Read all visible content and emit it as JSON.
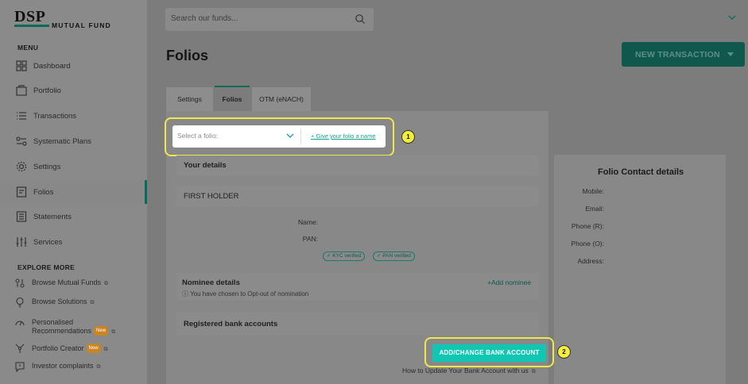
{
  "brand": {
    "name": "DSP",
    "tagline": "MUTUAL FUND",
    "color": "#0b6b5b"
  },
  "search": {
    "placeholder": "Search our funds..."
  },
  "sidebar": {
    "menu_title": "MENU",
    "items": [
      {
        "label": "Dashboard",
        "icon": "dashboard-icon"
      },
      {
        "label": "Portfolio",
        "icon": "portfolio-icon"
      },
      {
        "label": "Transactions",
        "icon": "transactions-icon"
      },
      {
        "label": "Systematic Plans",
        "icon": "systematic-plans-icon"
      },
      {
        "label": "Settings",
        "icon": "gear-icon"
      },
      {
        "label": "Folios",
        "icon": "folio-icon",
        "active": true
      },
      {
        "label": "Statements",
        "icon": "statements-icon"
      },
      {
        "label": "Services",
        "icon": "services-icon"
      }
    ],
    "explore_title": "EXPLORE MORE",
    "explore": [
      {
        "label": "Browse Mutual Funds",
        "icon": "browse-funds-icon"
      },
      {
        "label": "Browse Solutions",
        "icon": "bulb-icon"
      },
      {
        "label_line1": "Personalised",
        "label_line2": "Recommendations",
        "badge": "New",
        "icon": "gauge-icon"
      },
      {
        "label": "Portfolio Creator",
        "badge": "New",
        "icon": "portfolio-creator-icon"
      },
      {
        "label": "Investor complaints",
        "icon": "complaint-icon"
      }
    ]
  },
  "page": {
    "title": "Folios"
  },
  "new_transaction": {
    "label": "NEW TRANSACTION"
  },
  "tabs": [
    {
      "label": "Settings"
    },
    {
      "label": "Folios",
      "active": true
    },
    {
      "label": "OTM (eNACH)"
    }
  ],
  "folio_select": {
    "label": "Select a folio:",
    "value": "",
    "link": "+ Give your folio a name"
  },
  "annotations": {
    "one": "1",
    "two": "2",
    "highlight_color": "#f3ee3c"
  },
  "your_details": {
    "title": "Your details",
    "holder_title": "FIRST HOLDER",
    "name_label": "Name:",
    "pan_label": "PAN:",
    "kyc_pill": "✓ KYC verified",
    "pan_pill": "✓ PAN verified"
  },
  "nominee": {
    "title": "Nominee details",
    "note": "ⓘ You have chosen to Opt-out of nomination",
    "add_link": "+Add nominee"
  },
  "bank": {
    "title": "Registered bank accounts",
    "button": "ADD/CHANGE BANK ACCOUNT",
    "howto": "How to Update Your Bank Account with us"
  },
  "folio_contact": {
    "title": "Folio Contact details",
    "labels": [
      "Mobile:",
      "Email:",
      "Phone (R):",
      "Phone (O):",
      "Address:"
    ]
  }
}
